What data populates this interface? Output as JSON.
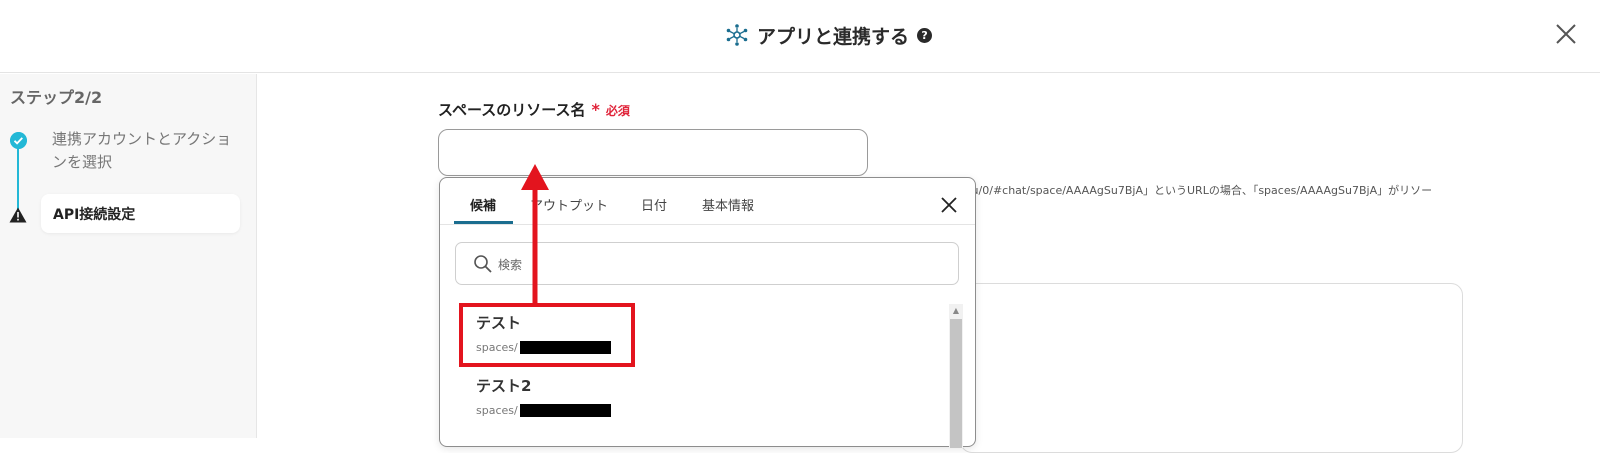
{
  "header": {
    "title": "アプリと連携する",
    "help_glyph": "?"
  },
  "sidebar": {
    "heading": "ステップ2/2",
    "steps": [
      {
        "label": "連携アカウントとアクションを選択",
        "status": "done"
      },
      {
        "label": "API接続設定",
        "status": "warning"
      }
    ]
  },
  "field": {
    "label": "スペースのリソース名",
    "required_mark": "*",
    "required_text": "必須",
    "value": "",
    "hint": "ail/u/0/#chat/space/AAAAgSu7BjA」というURLの場合、「spaces/AAAAgSu7BjA」がリソー"
  },
  "dropdown": {
    "tabs": [
      "候補",
      "アウトプット",
      "日付",
      "基本情報"
    ],
    "active_tab": "候補",
    "search_placeholder": "検索",
    "items": [
      {
        "name": "テスト",
        "path_prefix": "spaces/"
      },
      {
        "name": "テスト2",
        "path_prefix": "spaces/"
      }
    ]
  },
  "colors": {
    "accent": "#23b8d6",
    "required": "#e0243a",
    "annotation": "#e3141e",
    "tab_underline": "#1a6d8f"
  }
}
